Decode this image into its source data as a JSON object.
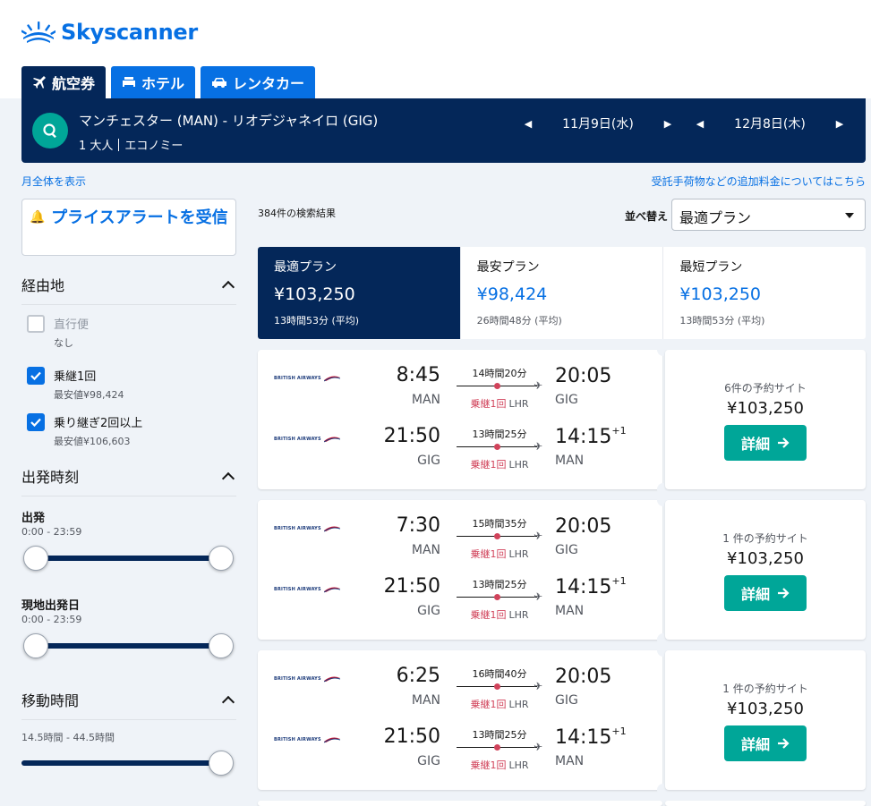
{
  "header": {
    "logo_text": "Skyscanner",
    "tabs": [
      {
        "label": "航空券",
        "icon": "plane-icon"
      },
      {
        "label": "ホテル",
        "icon": "bed-icon"
      },
      {
        "label": "レンタカー",
        "icon": "car-icon"
      }
    ]
  },
  "search": {
    "route": "マンチェスター (MAN) - リオデジャネイロ (GIG)",
    "passengers": "1 大人",
    "cabin": "エコノミー",
    "outbound_date": "11月9日(水)",
    "return_date": "12月8日(木)"
  },
  "links": {
    "month_view": "月全体を表示",
    "baggage_fees": "受託手荷物などの追加料金についてはこちら"
  },
  "sidebar": {
    "price_alert": "プライスアラートを受信",
    "stops_title": "経由地",
    "stops": [
      {
        "label": "直行便",
        "sub": "なし",
        "checked": false
      },
      {
        "label": "乗継1回",
        "sub": "最安値¥98,424",
        "checked": true
      },
      {
        "label": "乗り継ぎ2回以上",
        "sub": "最安値¥106,603",
        "checked": true
      }
    ],
    "times_title": "出発時刻",
    "departure_label": "出発",
    "departure_range": "0:00 - 23:59",
    "return_label": "現地出発日",
    "return_range": "0:00 - 23:59",
    "duration_title": "移動時間",
    "duration_range": "14.5時間 - 44.5時間"
  },
  "results": {
    "count": "384件の検索結果",
    "sort_label": "並べ替え",
    "sort_value": "最適プラン"
  },
  "price_tabs": [
    {
      "title": "最適プラン",
      "price": "¥103,250",
      "duration": "13時間53分 (平均)"
    },
    {
      "title": "最安プラン",
      "price": "¥98,424",
      "duration": "26時間48分 (平均)"
    },
    {
      "title": "最短プラン",
      "price": "¥103,250",
      "duration": "13時間53分 (平均)"
    }
  ],
  "flights": [
    {
      "sites": "6件の予約サイト",
      "price": "¥103,250",
      "button": "詳細",
      "legs": [
        {
          "dep_time": "8:45",
          "dep_airport": "MAN",
          "duration": "14時間20分",
          "stops": "乗継1回",
          "via": "LHR",
          "arr_time": "20:05",
          "arr_offset": "",
          "arr_airport": "GIG"
        },
        {
          "dep_time": "21:50",
          "dep_airport": "GIG",
          "duration": "13時間25分",
          "stops": "乗継1回",
          "via": "LHR",
          "arr_time": "14:15",
          "arr_offset": "+1",
          "arr_airport": "MAN"
        }
      ]
    },
    {
      "sites": "1 件の予約サイト",
      "price": "¥103,250",
      "button": "詳細",
      "legs": [
        {
          "dep_time": "7:30",
          "dep_airport": "MAN",
          "duration": "15時間35分",
          "stops": "乗継1回",
          "via": "LHR",
          "arr_time": "20:05",
          "arr_offset": "",
          "arr_airport": "GIG"
        },
        {
          "dep_time": "21:50",
          "dep_airport": "GIG",
          "duration": "13時間25分",
          "stops": "乗継1回",
          "via": "LHR",
          "arr_time": "14:15",
          "arr_offset": "+1",
          "arr_airport": "MAN"
        }
      ]
    },
    {
      "sites": "1 件の予約サイト",
      "price": "¥103,250",
      "button": "詳細",
      "legs": [
        {
          "dep_time": "6:25",
          "dep_airport": "MAN",
          "duration": "16時間40分",
          "stops": "乗継1回",
          "via": "LHR",
          "arr_time": "20:05",
          "arr_offset": "",
          "arr_airport": "GIG"
        },
        {
          "dep_time": "21:50",
          "dep_airport": "GIG",
          "duration": "13時間25分",
          "stops": "乗継1回",
          "via": "LHR",
          "arr_time": "14:15",
          "arr_offset": "+1",
          "arr_airport": "MAN"
        }
      ]
    }
  ],
  "airline": {
    "name": "BRITISH AIRWAYS",
    "logo_icon": "british-airways-logo-icon"
  },
  "colors": {
    "brand": "#0770e3",
    "navy": "#042759",
    "teal": "#00a698",
    "stop_red": "#d1435b",
    "background": "#eff3f8"
  }
}
